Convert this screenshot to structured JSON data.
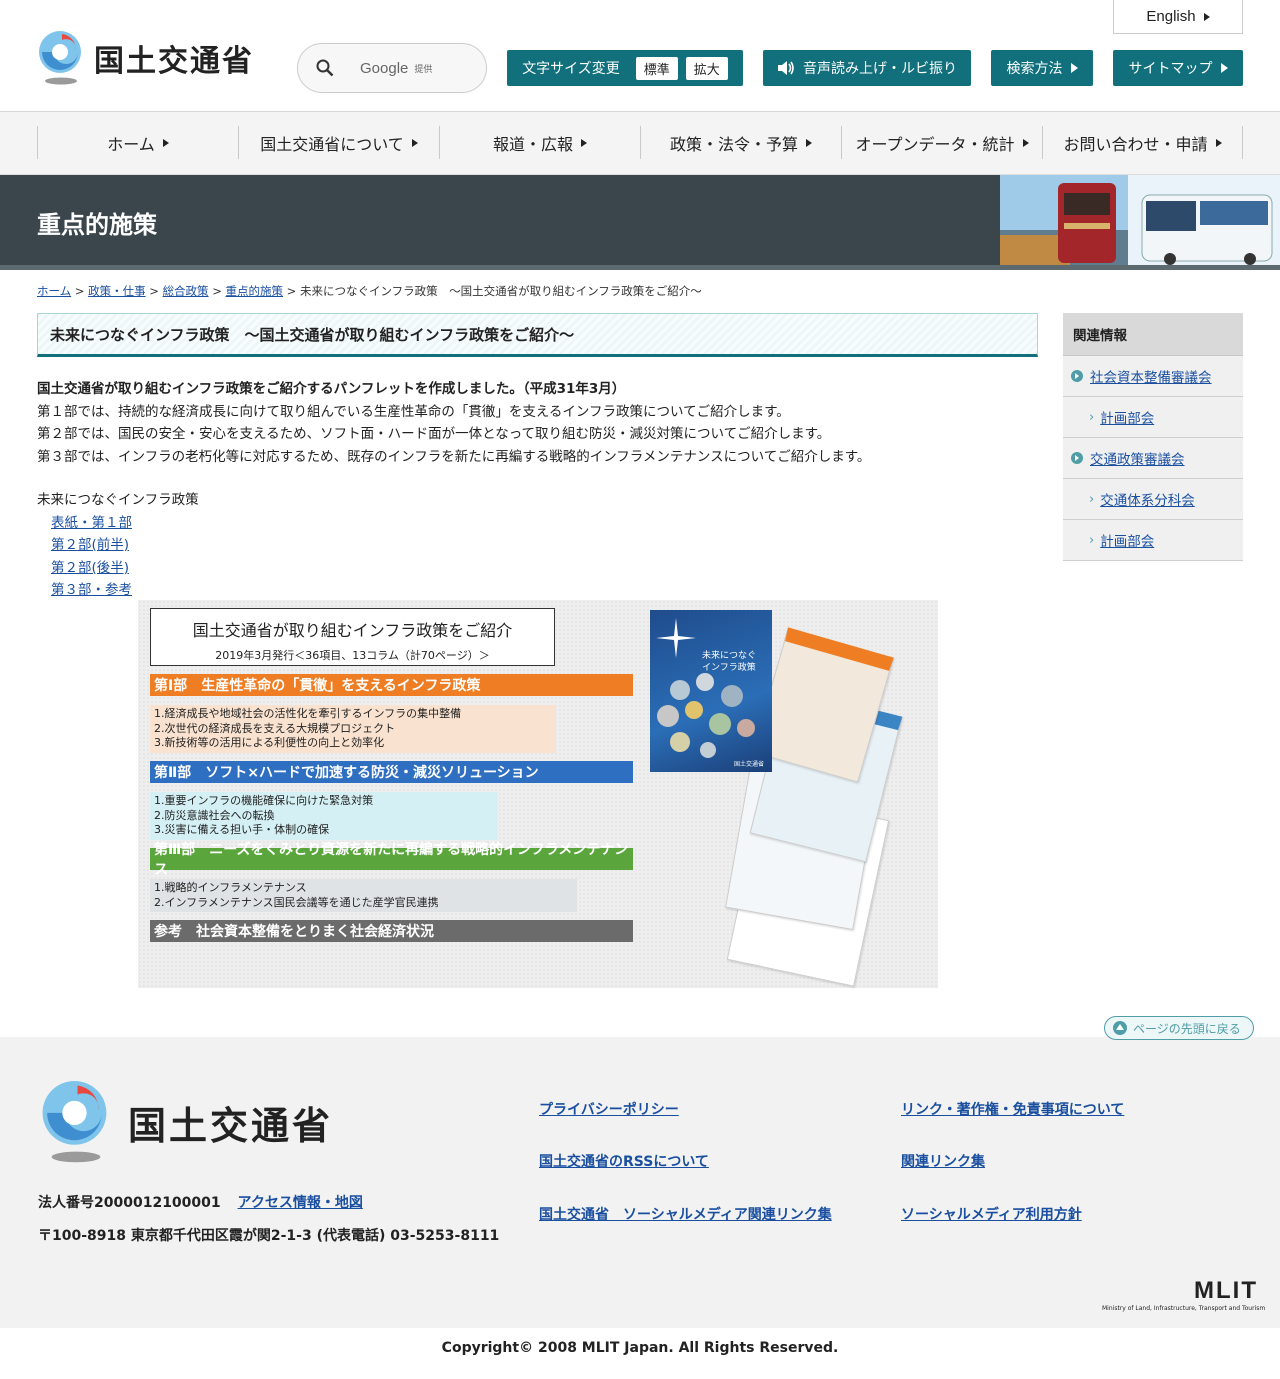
{
  "header": {
    "logo_text": "国土交通省",
    "search": {
      "engine": "Google",
      "suffix": "提供"
    },
    "english_label": "English",
    "fontsize": {
      "label": "文字サイズ変更",
      "standard": "標準",
      "large": "拡大"
    },
    "voice_label": "音声読み上げ・ルビ振り",
    "search_method_label": "検索方法",
    "sitemap_label": "サイトマップ"
  },
  "nav": [
    "ホーム",
    "国土交通省について",
    "報道・広報",
    "政策・法令・予算",
    "オープンデータ・統計",
    "お問い合わせ・申請"
  ],
  "band": {
    "title": "重点的施策"
  },
  "breadcrumb": {
    "items": [
      "ホーム",
      "政策・仕事",
      "総合政策",
      "重点的施策"
    ],
    "current": "未来につなぐインフラ政策　～国土交通省が取り組むインフラ政策をご紹介～"
  },
  "main": {
    "heading": "未来につなぐインフラ政策　～国土交通省が取り組むインフラ政策をご紹介～",
    "lead_bold": "国土交通省が取り組むインフラ政策をご紹介するパンフレットを作成しました。（平成31年3月）",
    "lead_lines": [
      "第１部では、持続的な経済成長に向けて取り組んでいる生産性革命の「貫徹」を支えるインフラ政策についてご紹介します。",
      "第２部では、国民の安全・安心を支えるため、ソフト面・ハード面が一体となって取り組む防災・減災対策についてご紹介します。",
      "第３部では、インフラの老朽化等に対応するため、既存のインフラを新たに再編する戦略的インフラメンテナンスについてご紹介します。"
    ],
    "pamphlet_title": "未来につなぐインフラ政策",
    "pamphlet_links": [
      "表紙・第１部",
      "第２部(前半)",
      "第２部(後半)",
      "第３部・参考"
    ]
  },
  "figure": {
    "title": "国土交通省が取り組むインフラ政策をご紹介",
    "subtitle": "2019年3月発行＜36項目、13コラム（計70ページ）＞",
    "cover_text": "未来につなぐ\nインフラ政策",
    "cover_publisher": "国土交通省",
    "parts": [
      {
        "title": "第Ⅰ部　生産性革命の「貫徹」を支えるインフラ政策",
        "color": "#ee7d23",
        "bg": "#f9e2d0",
        "items": [
          "1.経済成長や地域社会の活性化を牽引するインフラの集中整備",
          "2.次世代の経済成長を支える大規模プロジェクト",
          "3.新技術等の活用による利便性の向上と効率化"
        ]
      },
      {
        "title": "第Ⅱ部　ソフト×ハードで加速する防災・減災ソリューション",
        "color": "#2f6fc1",
        "bg": "#d4f0f4",
        "items": [
          "1.重要インフラの機能確保に向けた緊急対策",
          "2.防災意識社会への転換",
          "3.災害に備える担い手・体制の確保"
        ]
      },
      {
        "title": "第Ⅲ部　ニーズをくみとり資源を新たに再編する戦略的インフラメンテナンス",
        "color": "#5aa63c",
        "bg": "#dfe3e5",
        "items": [
          "1.戦略的インフラメンテナンス",
          "2.インフラメンテナンス国民会議等を通じた産学官民連携"
        ]
      },
      {
        "title": "参考　社会資本整備をとりまく社会経済状況",
        "color": "#6b6b6b",
        "bg": "",
        "items": []
      }
    ]
  },
  "side": {
    "heading": "関連情報",
    "items": [
      {
        "label": "社会資本整備審議会",
        "level": 1
      },
      {
        "label": "計画部会",
        "level": 2
      },
      {
        "label": "交通政策審議会",
        "level": 1
      },
      {
        "label": "交通体系分科会",
        "level": 2
      },
      {
        "label": "計画部会",
        "level": 2
      }
    ]
  },
  "totop_label": "ページの先頭に戻る",
  "footer": {
    "logo_text": "国土交通省",
    "corp_number": "法人番号2000012100001",
    "access_label": "アクセス情報・地図",
    "address": "〒100-8918 東京都千代田区霞が関2-1-3 (代表電話) 03-5253-8111",
    "links": [
      "プライバシーポリシー",
      "リンク・著作権・免責事項について",
      "国土交通省のRSSについて",
      "関連リンク集",
      "国土交通省　ソーシャルメディア関連リンク集",
      "ソーシャルメディア利用方針"
    ],
    "mlit_mark": "MLIT",
    "mlit_sub": "Ministry of Land, Infrastructure, Transport and Tourism",
    "copyright": "Copyright© 2008 MLIT Japan. All Rights Reserved."
  }
}
